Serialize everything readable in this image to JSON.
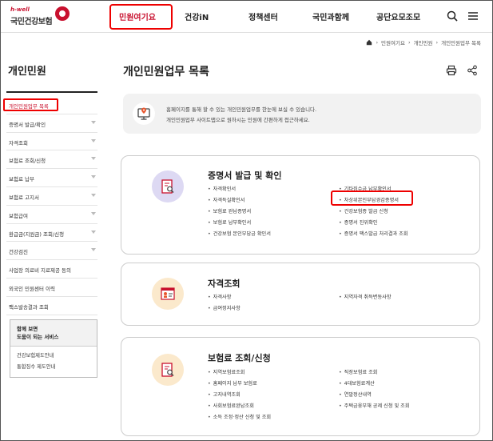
{
  "header": {
    "logo_small": "h-well",
    "logo_main": "국민건강보험",
    "nav": [
      "민원여기요",
      "건강iN",
      "정책센터",
      "국민과함께",
      "공단요모조모"
    ],
    "search_icon": "search-icon",
    "menu_icon": "menu-icon"
  },
  "breadcrumb": [
    "민원여기요",
    "개인민원",
    "개인민원업무 목록"
  ],
  "sidebar": {
    "title": "개인민원",
    "items": [
      {
        "label": "개인민원업무 목록",
        "expandable": false
      },
      {
        "label": "증명서 발급/확인",
        "expandable": true
      },
      {
        "label": "자격조회",
        "expandable": true
      },
      {
        "label": "보험료 조회/신청",
        "expandable": true
      },
      {
        "label": "보험료 납부",
        "expandable": true
      },
      {
        "label": "보험료 고지서",
        "expandable": true
      },
      {
        "label": "보험급여",
        "expandable": true
      },
      {
        "label": "환급금(지원금) 조회/신청",
        "expandable": true
      },
      {
        "label": "건강검진",
        "expandable": true
      },
      {
        "label": "사업장 의료비 지료제공 동의",
        "expandable": false
      },
      {
        "label": "외국인 민원센터 이력",
        "expandable": false
      },
      {
        "label": "팩스발송결과 조회",
        "expandable": false
      }
    ],
    "help": {
      "title_line1": "함께 보면",
      "title_line2": "도움이 되는 서비스",
      "links": [
        "건강보험제도안내",
        "통합징수 제도안내"
      ]
    }
  },
  "main": {
    "title": "개인민원업무 목록",
    "print_icon": "print-icon",
    "share_icon": "share-icon",
    "notice": {
      "line1": "홈페이지를 통해 할 수 있는 개인민원업무를 한눈에 보실 수 있습니다.",
      "line2": "개인민원업무 사이트맵으로 원하시는 민원에 간편하게 접근하세요."
    },
    "sections": [
      {
        "title": "증명서 발급 및 확인",
        "left": [
          "자격확인서",
          "자격득실확인서",
          "보험료 완납증명서",
          "보험료 납부확인서",
          "건강보험 본인부담금 확인서"
        ],
        "right": [
          "기타징수금 납부확인서",
          "차상위본인부담경감증명서",
          "건강보험증 발급 신청",
          "증명서 진위확인",
          "증명서 팩스발급 처리결과 조회"
        ]
      },
      {
        "title": "자격조회",
        "left": [
          "자격사항",
          "급여정지사항"
        ],
        "right": [
          "지역자격 취득변동사항"
        ]
      },
      {
        "title": "보험료 조회/신청",
        "left": [
          "지역보험료조회",
          "홈페이지 납부 보험료",
          "고지내역조회",
          "사회보험료완납조회",
          "소득 조정·정산 신청 및 조회"
        ],
        "right": [
          "직장보험료 조회",
          "4대보험료계산",
          "연말정산내역",
          "주택금융부채 공제 신청 및 조회"
        ]
      }
    ]
  }
}
